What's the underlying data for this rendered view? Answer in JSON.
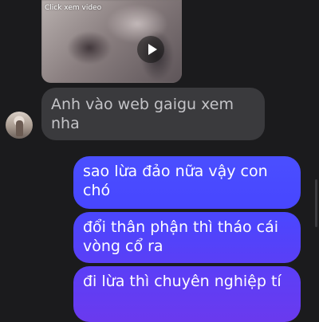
{
  "video": {
    "caption": "Click xem video",
    "play_icon": "play-icon"
  },
  "messages": {
    "incoming": [
      {
        "text": "Anh vào web gaigu xem nha"
      }
    ],
    "outgoing": [
      {
        "text": "sao lừa đảo nữa vậy con chó"
      },
      {
        "text": "đổi thân phận thì tháo cái vòng cổ ra"
      },
      {
        "text": "đi lừa thì chuyên nghiệp tí"
      }
    ]
  },
  "colors": {
    "background": "#1b1b1d",
    "incoming_bubble": "#3a3a3d",
    "outgoing_bubble_top": "#4a4fff",
    "outgoing_bubble_bottom": "#6a3aee"
  }
}
